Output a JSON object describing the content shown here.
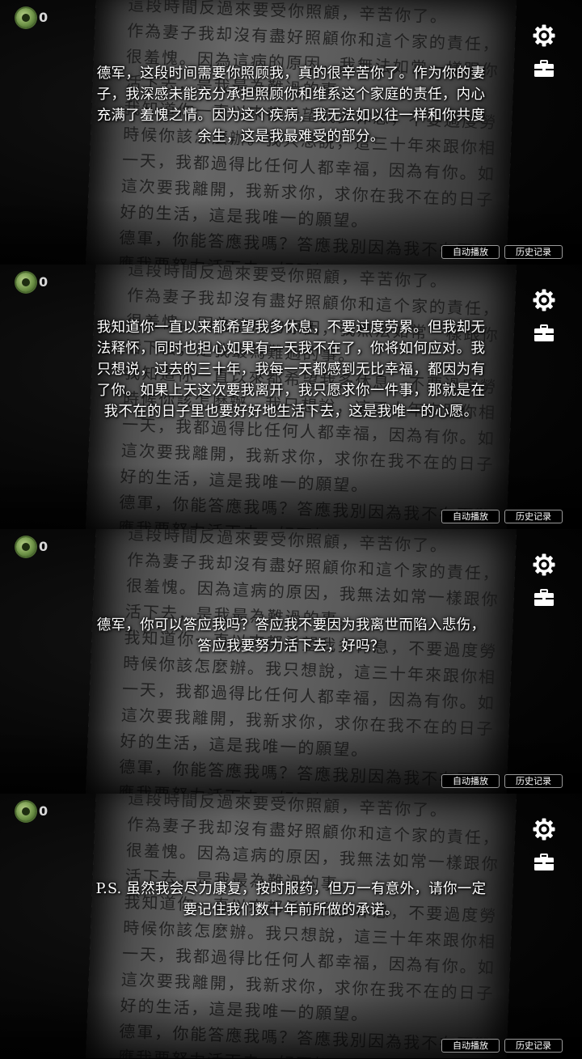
{
  "hud": {
    "coin_count": "0"
  },
  "buttons": {
    "auto_play": "自动播放",
    "history": "历史记录"
  },
  "letter_lines": [
    "這段時間反過來要受你照顧，辛苦你了。",
    "作為妻子我却沒有盡好照顧你和這个家的責任，我感到",
    "很羞愧。因為這病的原因，我無法如常一樣跟你一起生",
    "活下去，是我最為難過的事。",
    "我知道你一直以來都希望我多休息，不要過度勞累。",
    "時候你該怎麼辦。我只想說，這三十年來跟你相處的每",
    "一天，我都過得比任何人都幸福，因為有你。如果上天",
    "這次要我離開，我新求你，求你在我不在的日子也能好",
    "好的生活，這是我唯一的願望。",
    "德軍，你能答應我嗎？答應我別因為我不在而難過，答",
    "應我要努力活下去，好不好？"
  ],
  "panels": [
    {
      "dialogue": [
        "德军，这段时间需要你照顾我，真的很辛苦你了。作为你的妻",
        "子，我深感未能充分承担照顾你和维系这个家庭的责任，内心",
        "充满了羞愧之情。因为这个疾病，我无法如以往一样和你共度",
        "余生，这是我最难受的部分。"
      ]
    },
    {
      "dialogue": [
        "我知道你一直以来都希望我多休息，不要过度劳累。但我却无",
        "法释怀，同时也担心如果有一天我不在了，你将如何应对。我",
        "只想说，过去的三十年，我每一天都感到无比幸福，都因为有",
        "了你。如果上天这次要我离开，我只愿求你一件事，那就是在",
        "我不在的日子里也要好好地生活下去，这是我唯一的心愿。"
      ]
    },
    {
      "dialogue": [
        "德军，你可以答应我吗？答应我不要因为我离世而陷入悲伤，",
        "答应我要努力活下去，好吗？"
      ]
    },
    {
      "dialogue": [
        "P.S. 虽然我会尽力康复，按时服药，但万一有意外，请你一定",
        "要记住我们数十年前所做的承诺。"
      ]
    }
  ]
}
